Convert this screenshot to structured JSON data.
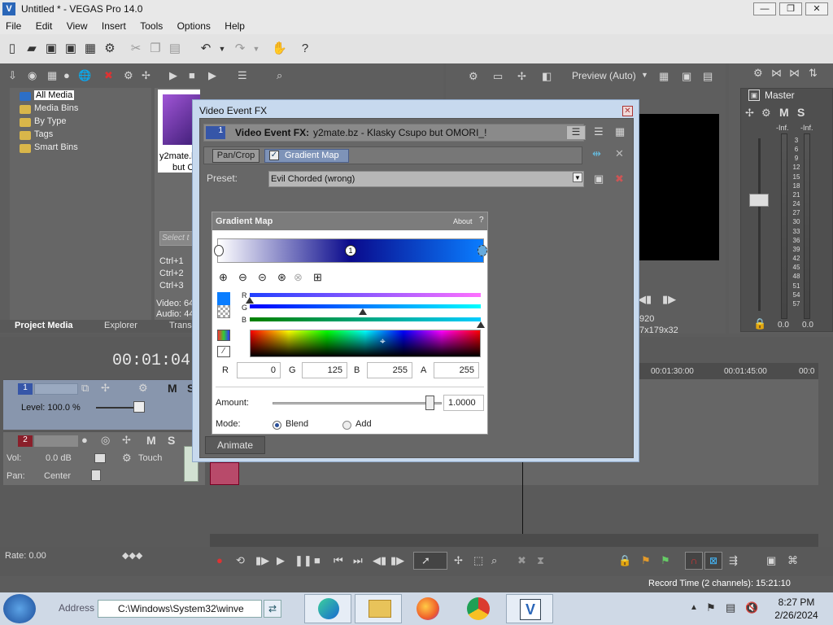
{
  "window": {
    "title": "Untitled * - VEGAS Pro 14.0"
  },
  "menu": [
    "File",
    "Edit",
    "View",
    "Insert",
    "Tools",
    "Options",
    "Help"
  ],
  "media_tree": {
    "items": [
      "All Media",
      "Media Bins",
      "By Type",
      "Tags",
      "Smart Bins"
    ]
  },
  "media_thumb": {
    "name_line1": "y2mate.b",
    "name_line2": "but C"
  },
  "shortcuts": [
    "Ctrl+1",
    "Ctrl+2",
    "Ctrl+3"
  ],
  "media_info": {
    "video": "Video: 64",
    "audio": "Audio: 44"
  },
  "search_placeholder": "Select t",
  "bottom_tabs": [
    "Project Media",
    "Explorer",
    "Transi"
  ],
  "preview": {
    "mode_label": "Preview (Auto)",
    "res1": "920",
    "res2": "7x179x32"
  },
  "master": {
    "label": "Master",
    "m": "M",
    "s": "S",
    "inf_left": "-Inf.",
    "inf_right": "-Inf.",
    "scale": [
      "3",
      "6",
      "9",
      "12",
      "15",
      "18",
      "21",
      "24",
      "27",
      "30",
      "33",
      "36",
      "39",
      "42",
      "45",
      "48",
      "51",
      "54",
      "57"
    ],
    "val_left": "0.0",
    "val_right": "0.0"
  },
  "timeline": {
    "timecode": "00:01:04:0",
    "marks": [
      "00:01:30:00",
      "00:01:45:00",
      "00:0"
    ]
  },
  "track1": {
    "num": "1",
    "level": "Level: 100.0 %",
    "m": "M",
    "s": "S"
  },
  "track2": {
    "num": "2",
    "vol": "Vol:",
    "vol_val": "0.0 dB",
    "pan": "Pan:",
    "pan_val": "Center",
    "touch": "Touch",
    "m": "M",
    "s": "S"
  },
  "rate": "Rate: 0.00",
  "record_time": "Record Time (2 channels): 15:21:10",
  "taskbar": {
    "address_label": "Address",
    "address_value": "C:\\Windows\\System32\\winve",
    "time": "8:27 PM",
    "date": "2/26/2024"
  },
  "dialog": {
    "title": "Video Event FX",
    "track_num": "1",
    "fx_label": "Video Event FX:",
    "fx_value": "y2mate.bz - Klasky Csupo but OMORI_!",
    "chain": [
      "Pan/Crop",
      "Gradient Map"
    ],
    "preset_label": "Preset:",
    "preset_value": "Evil Chorded (wrong)",
    "plugin": {
      "title": "Gradient Map",
      "about": "About",
      "help": "?",
      "marker_num": "1",
      "rgb_labels": [
        "R",
        "G",
        "B"
      ],
      "values": {
        "R_label": "R",
        "R": "0",
        "G_label": "G",
        "G": "125",
        "B_label": "B",
        "B": "255",
        "A_label": "A",
        "A": "255"
      },
      "amount_label": "Amount:",
      "amount_value": "1.0000",
      "amount_fraction": 0.93,
      "mode_label": "Mode:",
      "mode_options": [
        "Blend",
        "Add"
      ],
      "mode_selected": "Blend",
      "slider_r": 0.0,
      "slider_g": 0.49,
      "slider_b": 1.0
    },
    "animate": "Animate"
  },
  "colors": {
    "accent": "#0050ff",
    "gradient_start": "#ffffff",
    "gradient_mid": "#0a0a8c",
    "gradient_end": "#0a7dff"
  }
}
